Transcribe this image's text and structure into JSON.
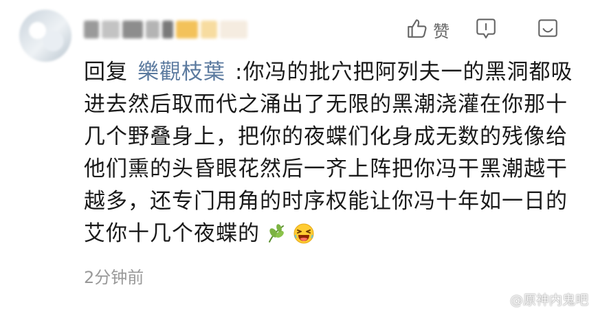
{
  "comment": {
    "actions": {
      "like_label": "赞"
    },
    "reply_prefix": "回复",
    "reply_to_user": "樂觀枝葉",
    "text": ":你冯的批穴把阿列夫一的黑洞都吸进去然后取而代之涌出了无限的黑潮浇灌在你那十几个野叠身上，把你的夜蝶们化身成无数的残像给他们熏的头昏眼花然后一齐上阵把你冯干黑潮越干越多，还专门用角的时序权能让你冯十年如一日的艾你十几个夜蝶的",
    "emojis": [
      "leaf-emoji",
      "laughing-emoji"
    ],
    "timestamp": "2分钟前"
  },
  "watermark": {
    "text": "@原神内鬼吧"
  }
}
